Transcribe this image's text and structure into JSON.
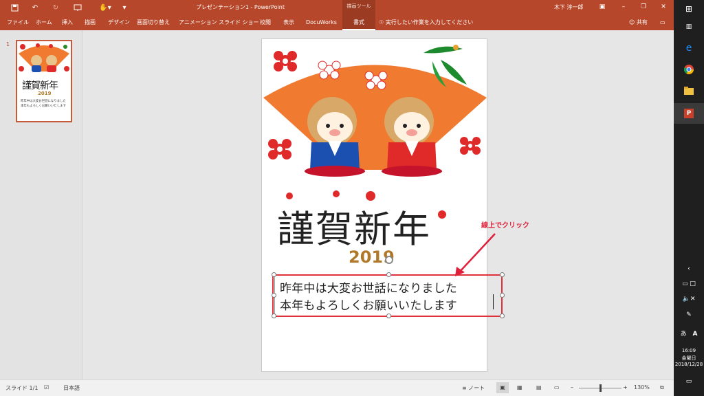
{
  "app": {
    "title": "プレゼンテーション1 - PowerPoint",
    "context_tool": "描画ツール",
    "user": "木下 淳一郎",
    "share": "共有"
  },
  "tabs": [
    {
      "label": "ファイル"
    },
    {
      "label": "ホーム"
    },
    {
      "label": "挿入"
    },
    {
      "label": "描画"
    },
    {
      "label": "デザイン"
    },
    {
      "label": "画面切り替え"
    },
    {
      "label": "アニメーション"
    },
    {
      "label": "スライド ショー"
    },
    {
      "label": "校閲"
    },
    {
      "label": "表示"
    },
    {
      "label": "DocuWorks"
    },
    {
      "label": "書式"
    }
  ],
  "tellme": "実行したい作業を入力してください",
  "thumbnails": {
    "slide_number": "1",
    "thumb_title": "謹賀新年",
    "thumb_year": "2019",
    "thumb_line1": "昨年中は大変お世話になりました",
    "thumb_line2": "本年もよろしくお願いいたします"
  },
  "slide": {
    "title": "謹賀新年",
    "year": "2019",
    "line1": "昨年中は大変お世話になりました",
    "line2": "本年もよろしくお願いいたします"
  },
  "annotation": "線上でクリック",
  "statusbar": {
    "slide_indicator": "スライド 1/1",
    "language": "日本語",
    "notes": "ノート",
    "zoom": "130%"
  },
  "taskbar": {
    "ime": "あ",
    "time": "16:09",
    "weekday": "金曜日",
    "date": "2018/12/28"
  },
  "colors": {
    "ribbon": "#b7472a",
    "highlight": "#e0303a",
    "fan": "#f07a30"
  }
}
